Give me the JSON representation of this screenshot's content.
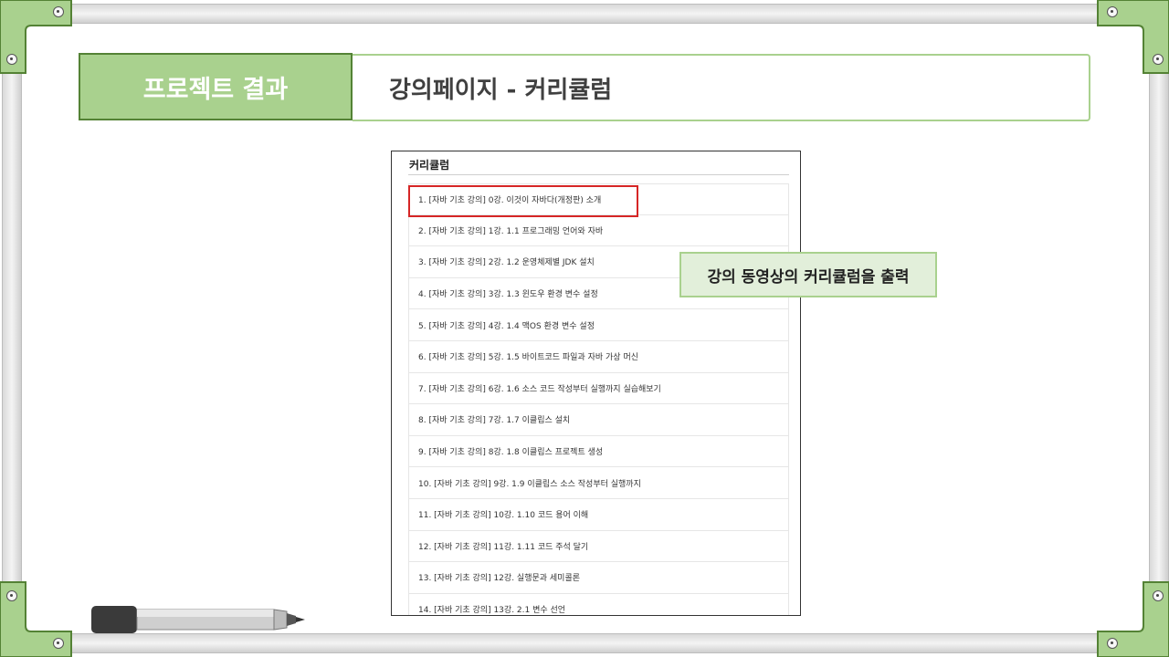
{
  "slide": {
    "section_label": "프로젝트 결과",
    "title": "강의페이지 - 커리큘럼"
  },
  "curriculum": {
    "title": "커리큘럼",
    "items": [
      "1. [자바 기초 강의] 0강. 이것이 자바다(개정판) 소개",
      "2. [자바 기초 강의] 1강. 1.1 프로그래밍 언어와 자바",
      "3. [자바 기초 강의] 2강. 1.2 운영체제별 JDK 설치",
      "4. [자바 기초 강의] 3강. 1.3 윈도우 환경 변수 설정",
      "5. [자바 기초 강의] 4강. 1.4 맥OS 환경 변수 설정",
      "6. [자바 기초 강의] 5강. 1.5 바이트코드 파일과 자바 가상 머신",
      "7. [자바 기초 강의] 6강. 1.6 소스 코드 작성부터 실행까지 실습해보기",
      "8. [자바 기초 강의] 7강. 1.7 이클립스 설치",
      "9. [자바 기초 강의] 8강. 1.8 이클립스 프로젝트 생성",
      "10. [자바 기초 강의] 9강. 1.9 이클립스 소스 작성부터 실행까지",
      "11. [자바 기초 강의] 10강. 1.10 코드 용어 이해",
      "12. [자바 기초 강의] 11강. 1.11 코드 주석 달기",
      "13. [자바 기초 강의] 12강. 실행문과 세미콜론",
      "14. [자바 기초 강의] 13강. 2.1 변수 선언"
    ]
  },
  "callout": {
    "text": "강의 동영상의 커리큘럼을 출력"
  },
  "colors": {
    "accent_green": "#a9d18e",
    "dark_green": "#548235",
    "callout_bg": "#e2efda",
    "highlight_red": "#d62626"
  }
}
